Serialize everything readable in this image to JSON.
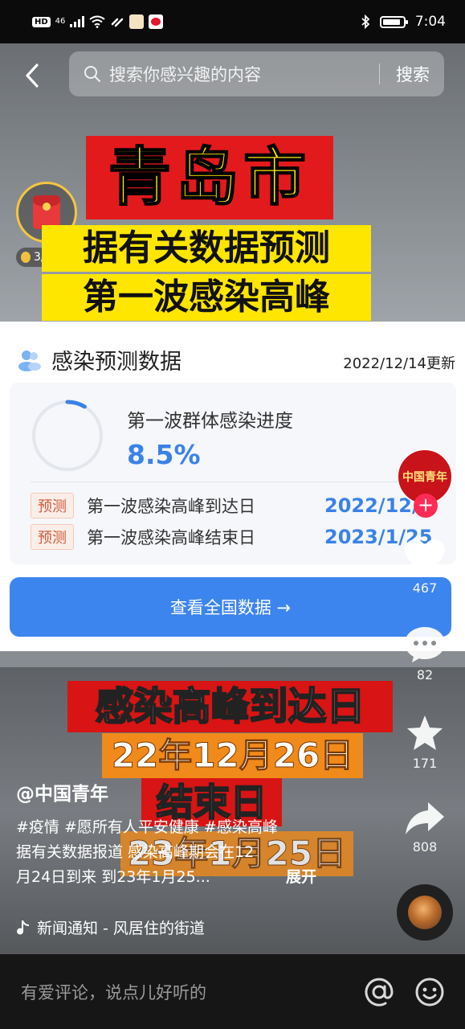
{
  "status_bar": {
    "hd": "HD",
    "network": "46",
    "time": "7:04",
    "battery_level": 0.9
  },
  "header": {
    "search_placeholder": "搜索你感兴趣的内容",
    "search_button": "搜索"
  },
  "red_packet": {
    "count": "3/8"
  },
  "video_titles": {
    "city": "青岛市",
    "line1": "据有关数据预测",
    "line2": "第一波感染高峰"
  },
  "card": {
    "title": "感染预测数据",
    "updated": "2022/12/14更新",
    "progress_label": "第一波群体感染进度",
    "progress_value": "8.5%",
    "progress_fraction": 0.085,
    "predictions": [
      {
        "tag": "预测",
        "label": "第一波感染高峰到达日",
        "value": "2022/12/"
      },
      {
        "tag": "预测",
        "label": "第一波感染高峰结束日",
        "value": "2023/1/25"
      }
    ],
    "view_button": "查看全国数据 →"
  },
  "lower_banners": {
    "arrive": "感染高峰到达日",
    "arrive_date": "22年12月26日",
    "end": "结束日",
    "end_date": "23年1月25日"
  },
  "actions": {
    "avatar_text": "中国青年",
    "like_count": "467",
    "comment_count": "82",
    "favorite_count": "171",
    "share_count": "808"
  },
  "caption": {
    "author": "@中国青年",
    "line1": "#疫情 #愿所有人平安健康 #感染高峰",
    "line2": "据有关数据报道 感染高峰期会在12",
    "line3": "月24日到来 到23年1月25...",
    "more": "展开",
    "music": "新闻通知 - 风居住的街道"
  },
  "comment_bar": {
    "placeholder": "有爱评论，说点儿好听的"
  },
  "colors": {
    "accent_blue": "#3d85ee",
    "banner_red": "#e31a1c",
    "banner_yellow": "#ffe600",
    "follow_red": "#fe2c55"
  }
}
